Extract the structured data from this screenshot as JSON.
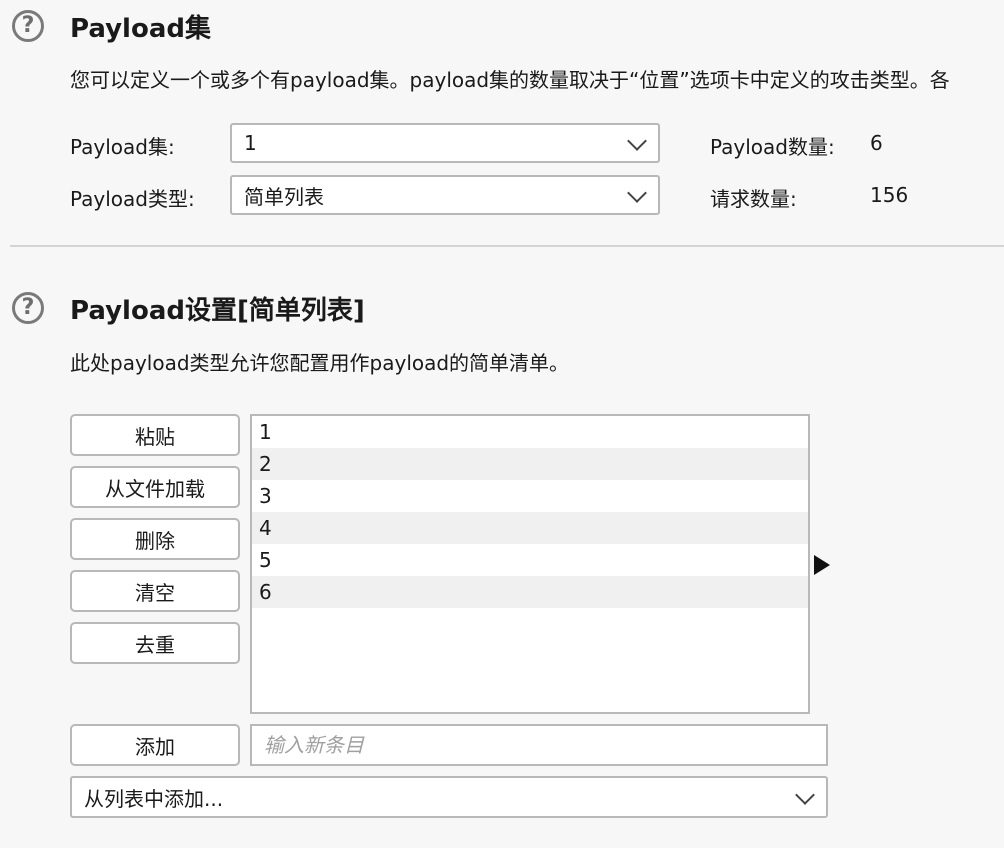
{
  "payload_sets": {
    "title": "Payload集",
    "description": "您可以定义一个或多个有payload集。payload集的数量取决于“位置”选项卡中定义的攻击类型。各",
    "set_label": "Payload集:",
    "set_value": "1",
    "type_label": "Payload类型:",
    "type_value": "简单列表",
    "count_label": "Payload数量:",
    "count_value": "6",
    "request_label": "请求数量:",
    "request_value": "156"
  },
  "payload_settings": {
    "title": "Payload设置[简单列表]",
    "description": "此处payload类型允许您配置用作payload的简单清单。",
    "buttons": {
      "paste": "粘贴",
      "load": "从文件加载",
      "remove": "删除",
      "clear": "清空",
      "dedup": "去重",
      "add": "添加"
    },
    "items": [
      "1",
      "2",
      "3",
      "4",
      "5",
      "6"
    ],
    "new_item_placeholder": "输入新条目",
    "add_from_list": "从列表中添加..."
  },
  "icons": {
    "help": "help-icon",
    "chevron": "chevron-down-icon",
    "expand": "triangle-right-icon"
  }
}
